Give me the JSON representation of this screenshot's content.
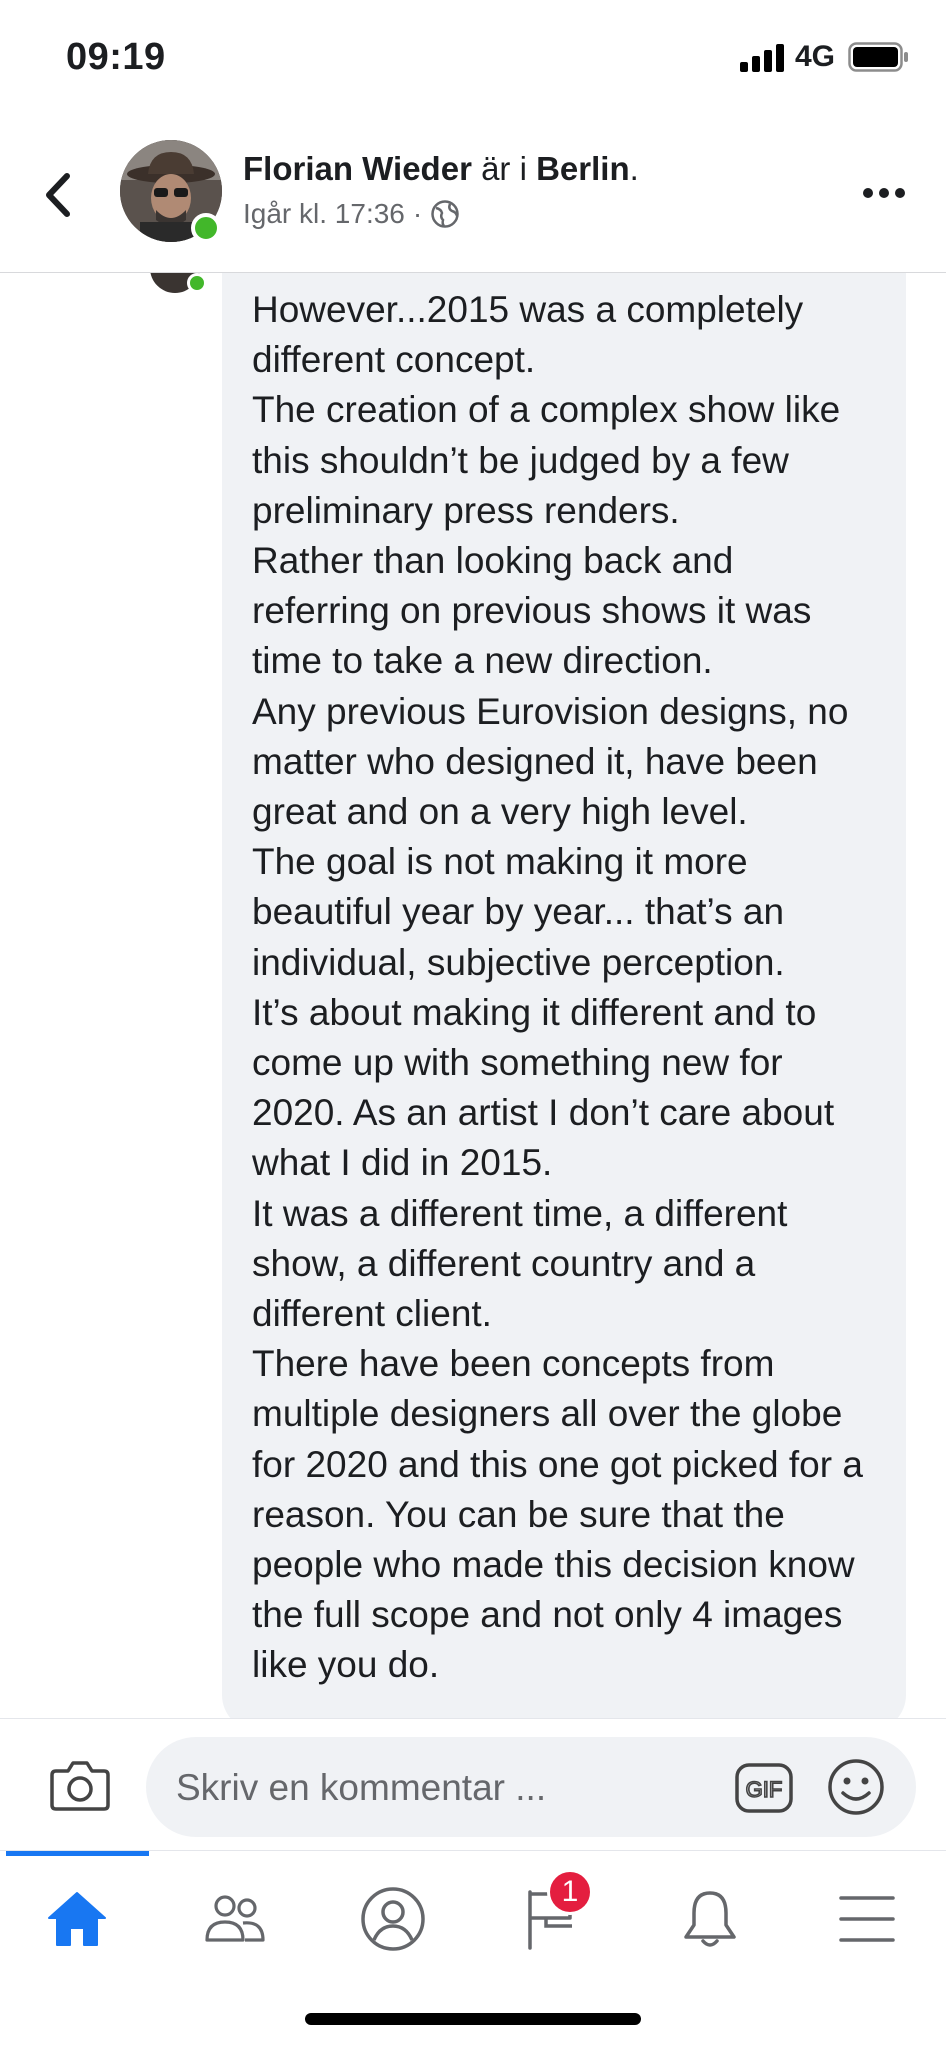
{
  "status_bar": {
    "time": "09:19",
    "network": "4G"
  },
  "header": {
    "author": "Florian Wieder",
    "connector": "är i",
    "location": "Berlin",
    "period": ".",
    "timestamp": "Igår kl. 17:36",
    "separator": "·"
  },
  "comment": {
    "lines": [
      "However...2015 was a completely different concept.",
      "The creation of a complex show like this shouldn’t be judged by a few preliminary press renders.",
      "Rather than looking back and referring on previous shows it was time to take a new direction.",
      "Any previous Eurovision designs, no matter who designed it, have been great and on a very high level.",
      "The goal is not making it more beautiful year by year... that’s an individual, subjective perception.",
      "It’s about making it different and to come up with something new for 2020. As an artist I don’t care about what I did in 2015.",
      "It was a different time, a different show, a different country and a different client.",
      "There have been concepts from multiple designers all over the globe for 2020 and this one got picked for a reason. You can be sure that the people who made this decision know the full scope and not only 4 images like you do."
    ]
  },
  "composer": {
    "placeholder": "Skriv en kommentar ...",
    "gif_label": "GIF"
  },
  "tabbar": {
    "tabs": [
      {
        "name": "home",
        "icon": "home-icon",
        "active": true
      },
      {
        "name": "friends",
        "icon": "friends-icon",
        "active": false
      },
      {
        "name": "profile",
        "icon": "profile-icon",
        "active": false
      },
      {
        "name": "pages",
        "icon": "flag-icon",
        "active": false,
        "badge": "1"
      },
      {
        "name": "notifications",
        "icon": "bell-icon",
        "active": false
      },
      {
        "name": "menu",
        "icon": "menu-icon",
        "active": false
      }
    ]
  },
  "colors": {
    "accent": "#1877f2",
    "online": "#42b72a",
    "badge": "#e41e3f",
    "bubble": "#f0f2f5"
  }
}
